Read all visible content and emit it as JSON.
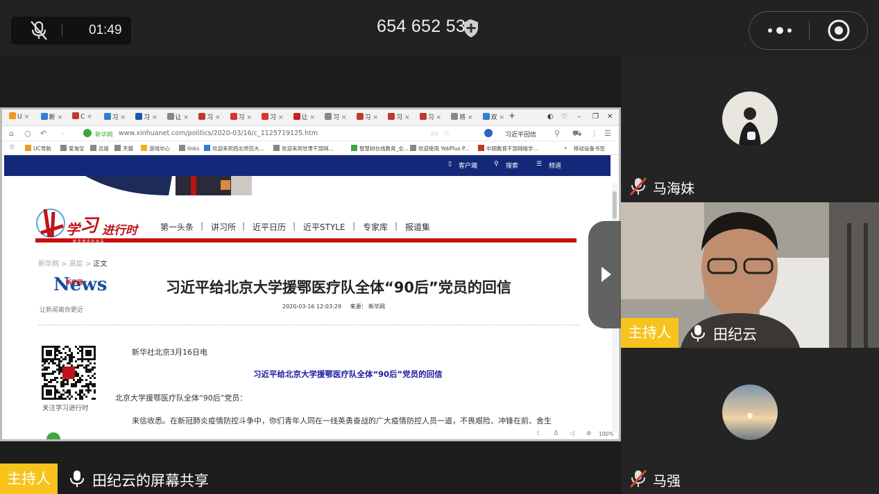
{
  "top_bar": {
    "timer": "01:49",
    "meeting_id": "654 652 532"
  },
  "browser": {
    "tabs": [
      {
        "label": "U",
        "color": "#f29a1c"
      },
      {
        "label": "新",
        "color": "#2f7ed8"
      },
      {
        "label": "C",
        "color": "#c0392b"
      },
      {
        "label": "习",
        "color": "#2f7ed8"
      },
      {
        "label": "习",
        "color": "#1a57b5"
      },
      {
        "label": "让",
        "color": "#888888"
      },
      {
        "label": "习",
        "color": "#c0392b"
      },
      {
        "label": "习",
        "color": "#d9352a"
      },
      {
        "label": "习",
        "color": "#d9352a"
      },
      {
        "label": "让",
        "color": "#cc1f1f"
      },
      {
        "label": "习",
        "color": "#888888"
      },
      {
        "label": "习",
        "color": "#c0392b"
      },
      {
        "label": "习",
        "color": "#c0392b"
      },
      {
        "label": "习",
        "color": "#c0392b"
      },
      {
        "label": "将",
        "color": "#888888"
      },
      {
        "label": "双",
        "color": "#2f7ed8"
      }
    ],
    "new_tab": "+",
    "site_label": "新华网",
    "url": "www.xinhuanet.com/politics/2020-03/16/c_1125719125.htm",
    "search_text": "习近平回信",
    "bookmarks": [
      "UC导航",
      "爱淘宝",
      "百度",
      "天猫",
      "游戏中心",
      "links",
      "欢迎来到西北师范大...",
      "欢迎来到甘肃干部网...",
      "智慧树在线教育_全...",
      "欢迎使用 YebPlus P...",
      "中国教育干部网络学..."
    ],
    "bookmark_more": "»",
    "mobile_bookmarks": "移动设备书签",
    "zoom": "100%"
  },
  "page": {
    "nav": {
      "client": "客户端",
      "search": "搜索",
      "channel": "频道"
    },
    "logo_text": "学习进行时",
    "logo_sub": "新 华 通 讯 社 出 品",
    "menu": [
      "第一头条",
      "讲习所",
      "近平日历",
      "近平STYLE",
      "专家库",
      "报道集"
    ],
    "menu_sep": "|",
    "breadcrumb": {
      "home": "新华网",
      "sep": ">",
      "section": "高层",
      "current": "正文"
    },
    "news_logo": {
      "name": "新华网",
      "en": "News",
      "slogan": "让新闻离你更近"
    },
    "article_title": "习近平给北京大学援鄂医疗队全体“90后”党员的回信",
    "article_time": "2020-03-16 12:03:29",
    "article_source": "来源：  新华网",
    "qr_caption": "关注学习进行时",
    "dateline": "新华社北京3月16日电",
    "letter_title": "习近平给北京大学援鄂医疗队全体“90后”党员的回信",
    "salutation": "北京大学援鄂医疗队全体“90后”党员：",
    "body_line": "来信收悉。在新冠肺炎疫情防控斗争中，你们青年人同在一线英勇奋战的广大疫情防控人员一道，不畏艰险、冲锋在前、舍生"
  },
  "host_label": "主持人",
  "share_label": "田纪云的屏幕共享",
  "participants": {
    "p1": "马海妹",
    "video": "田纪云",
    "p2": "马强"
  }
}
